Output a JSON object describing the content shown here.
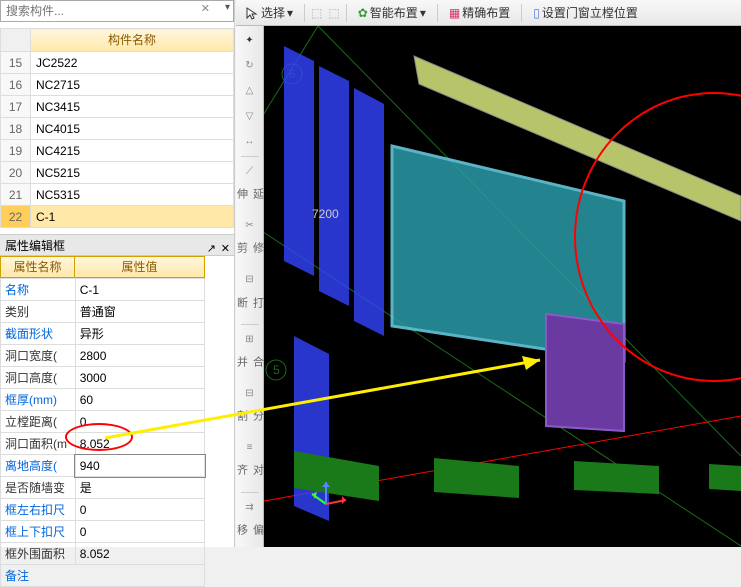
{
  "search": {
    "placeholder": "搜索构件..."
  },
  "component_header": "构件名称",
  "components": [
    {
      "num": "15",
      "name": "JC2522"
    },
    {
      "num": "16",
      "name": "NC2715"
    },
    {
      "num": "17",
      "name": "NC3415"
    },
    {
      "num": "18",
      "name": "NC4015"
    },
    {
      "num": "19",
      "name": "NC4215"
    },
    {
      "num": "20",
      "name": "NC5215"
    },
    {
      "num": "21",
      "name": "NC5315"
    },
    {
      "num": "22",
      "name": "C-1"
    }
  ],
  "prop_panel_title": "属性编辑框",
  "prop_headers": {
    "name": "属性名称",
    "value": "属性值"
  },
  "props": [
    {
      "lbl": "名称",
      "val": "C-1",
      "blue": true
    },
    {
      "lbl": "类别",
      "val": "普通窗",
      "blue": false
    },
    {
      "lbl": "截面形状",
      "val": "异形",
      "blue": true
    },
    {
      "lbl": "洞口宽度(",
      "val": "2800",
      "blue": false
    },
    {
      "lbl": "洞口高度(",
      "val": "3000",
      "blue": false
    },
    {
      "lbl": "框厚(mm)",
      "val": "60",
      "blue": true
    },
    {
      "lbl": "立樘距离(",
      "val": "0",
      "blue": false
    },
    {
      "lbl": "洞口面积(m",
      "val": "8.052",
      "blue": false
    },
    {
      "lbl": "离地高度(",
      "val": "940",
      "blue": true,
      "edit": true
    },
    {
      "lbl": "是否随墙变",
      "val": "是",
      "blue": false
    },
    {
      "lbl": "框左右扣尺",
      "val": "0",
      "blue": true
    },
    {
      "lbl": "框上下扣尺",
      "val": "0",
      "blue": true
    },
    {
      "lbl": "框外围面积",
      "val": "8.052",
      "blue": false
    }
  ],
  "prop_more": "备注",
  "toolbar": {
    "select": "选择",
    "smart": "智能布置",
    "precise": "精确布置",
    "setpos": "设置门窗立樘位置"
  },
  "vtool": {
    "extend": "延伸",
    "trim": "修剪",
    "break": "打断",
    "merge": "合并",
    "split": "分割",
    "align": "对齐",
    "offset": "偏移"
  },
  "viewport": {
    "dim": "7200",
    "grid5": "5",
    "grid6": "6"
  }
}
